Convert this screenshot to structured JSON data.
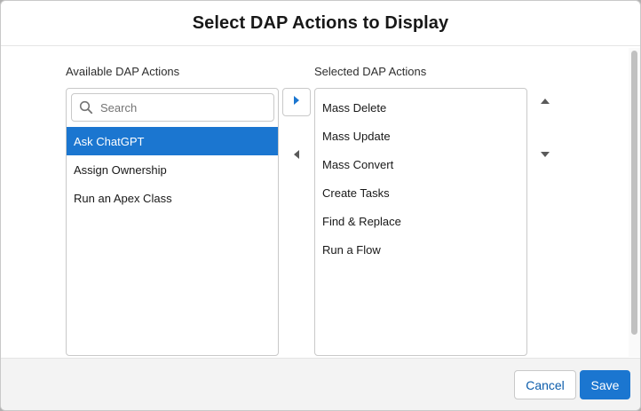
{
  "modal": {
    "title": "Select DAP Actions to Display"
  },
  "available": {
    "label": "Available DAP Actions",
    "search_placeholder": "Search",
    "items": [
      "Ask ChatGPT",
      "Assign Ownership",
      "Run an Apex Class"
    ],
    "selected_item": "Ask ChatGPT"
  },
  "selected": {
    "label": "Selected DAP Actions",
    "items": [
      "Mass Delete",
      "Mass Update",
      "Mass Convert",
      "Create Tasks",
      "Find & Replace",
      "Run a Flow"
    ]
  },
  "icons": {
    "search": "search-icon",
    "move_right": "right-triangle-icon",
    "move_left": "left-triangle-icon",
    "move_up": "up-triangle-icon",
    "move_down": "down-triangle-icon"
  },
  "footer": {
    "cancel_label": "Cancel",
    "save_label": "Save"
  },
  "colors": {
    "brand": "#1b76d0",
    "selected_row": "#1b76d0",
    "link_text": "#0b5cab"
  }
}
